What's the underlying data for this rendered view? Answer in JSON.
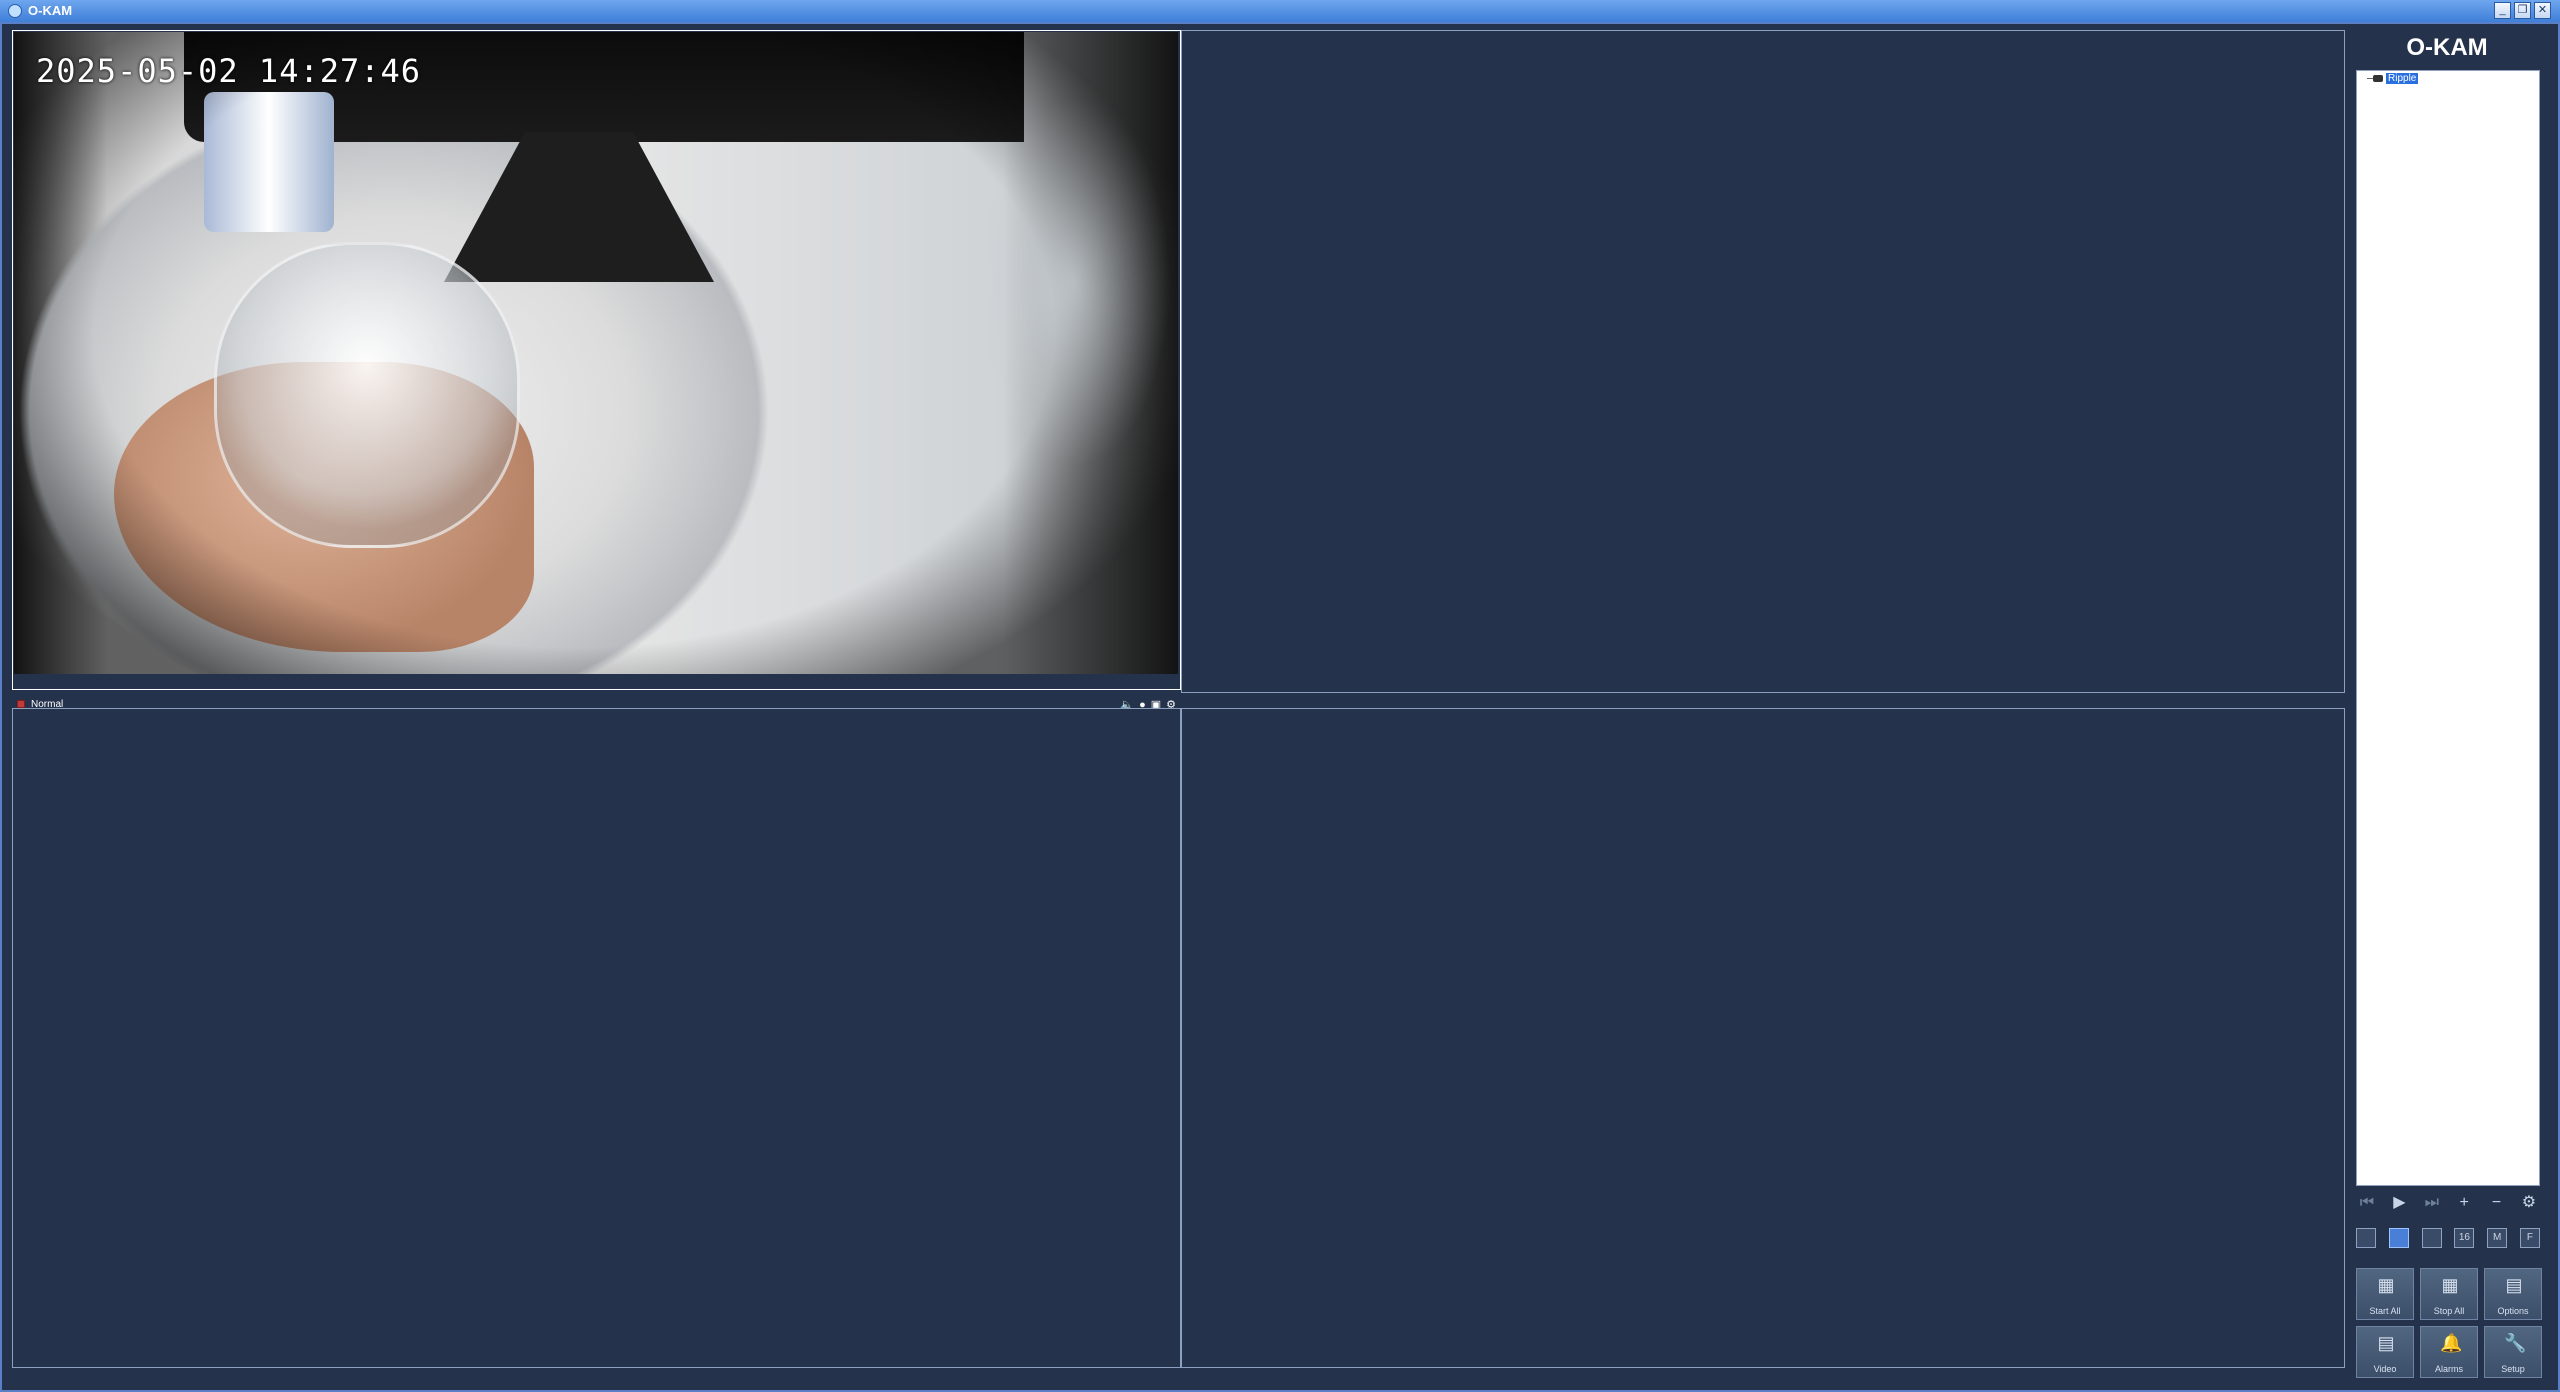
{
  "window": {
    "title": "O-KAM",
    "controls": [
      "minimize",
      "restore",
      "close"
    ]
  },
  "viewer": {
    "tiles": [
      {
        "id": 1,
        "active": true,
        "timestamp": "2025-05-02 14:27:46",
        "status_label": "Normal",
        "status_icons": [
          "audio-icon",
          "record-icon",
          "snapshot-icon",
          "settings-icon"
        ]
      },
      {
        "id": 2,
        "active": false
      },
      {
        "id": 3,
        "active": false
      },
      {
        "id": 4,
        "active": false
      }
    ]
  },
  "sidebar": {
    "brand": "O-KAM",
    "device_tree": [
      {
        "name": "Ripple",
        "selected": true
      }
    ],
    "playback_controls": [
      "first-icon",
      "play-icon",
      "last-icon",
      "zoom-in-icon",
      "zoom-out-icon",
      "gear-icon"
    ],
    "layouts": [
      {
        "label": "",
        "name": "layout-1",
        "selected": false
      },
      {
        "label": "",
        "name": "layout-4",
        "selected": true
      },
      {
        "label": "",
        "name": "layout-9",
        "selected": false
      },
      {
        "label": "16",
        "name": "layout-16",
        "selected": false
      },
      {
        "label": "M",
        "name": "layout-m",
        "selected": false
      },
      {
        "label": "F",
        "name": "layout-full",
        "selected": false
      }
    ],
    "actions_row1": [
      {
        "label": "Start All",
        "icon": "start-all-icon"
      },
      {
        "label": "Stop All",
        "icon": "stop-all-icon"
      },
      {
        "label": "Options",
        "icon": "options-icon"
      }
    ],
    "actions_row2": [
      {
        "label": "Video",
        "icon": "video-icon"
      },
      {
        "label": "Alarms",
        "icon": "bell-icon"
      },
      {
        "label": "Setup",
        "icon": "wrench-icon"
      }
    ]
  },
  "colors": {
    "background": "#24334b",
    "titlebar": "#4a8ae0",
    "selected": "#2a6fe0",
    "status_led": "#c43a3a"
  }
}
